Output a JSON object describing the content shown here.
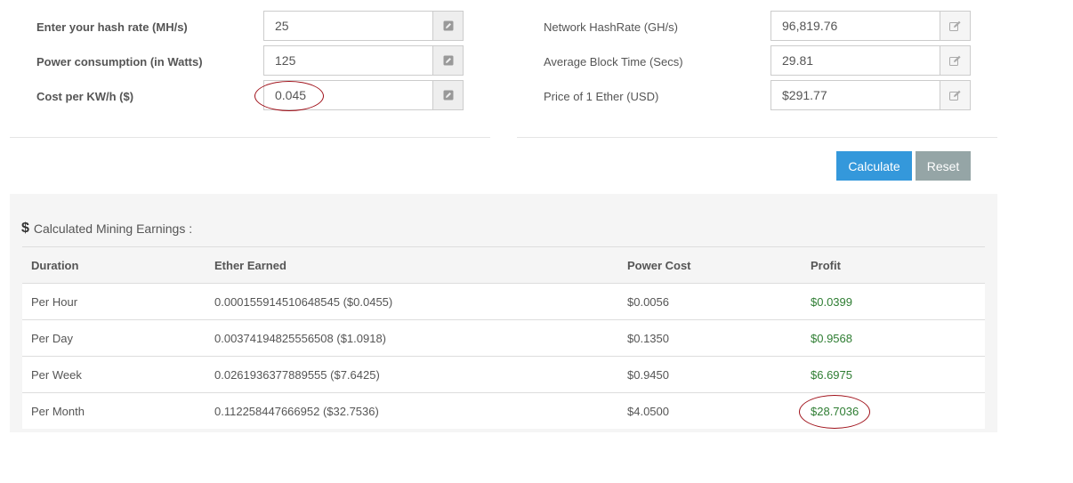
{
  "left_form": {
    "hash_rate": {
      "label": "Enter your hash rate (MH/s)",
      "value": "25"
    },
    "power": {
      "label": "Power consumption (in Watts)",
      "value": "125"
    },
    "cost": {
      "label": "Cost per KW/h ($)",
      "value": "0.045"
    }
  },
  "right_form": {
    "network_hashrate": {
      "label": "Network HashRate (GH/s)",
      "value": "96,819.76"
    },
    "block_time": {
      "label": "Average Block Time (Secs)",
      "value": "29.81"
    },
    "ether_price": {
      "label": "Price of 1 Ether (USD)",
      "value": "$291.77"
    }
  },
  "buttons": {
    "calculate": "Calculate",
    "reset": "Reset"
  },
  "results": {
    "icon": "$",
    "title": "Calculated Mining Earnings :",
    "headers": [
      "Duration",
      "Ether Earned",
      "Power Cost",
      "Profit"
    ],
    "rows": [
      [
        "Per Hour",
        "0.000155914510648545 ($0.0455)",
        "$0.0056",
        "$0.0399"
      ],
      [
        "Per Day",
        "0.00374194825556508 ($1.0918)",
        "$0.1350",
        "$0.9568"
      ],
      [
        "Per Week",
        "0.0261936377889555 ($7.6425)",
        "$0.9450",
        "$6.6975"
      ],
      [
        "Per Month",
        "0.112258447666952 ($32.7536)",
        "$4.0500",
        "$28.7036"
      ]
    ]
  },
  "colors": {
    "calculate": "#3498db",
    "reset": "#95a5a6",
    "profit": "#2e7d32",
    "annotation": "#a0111a"
  }
}
